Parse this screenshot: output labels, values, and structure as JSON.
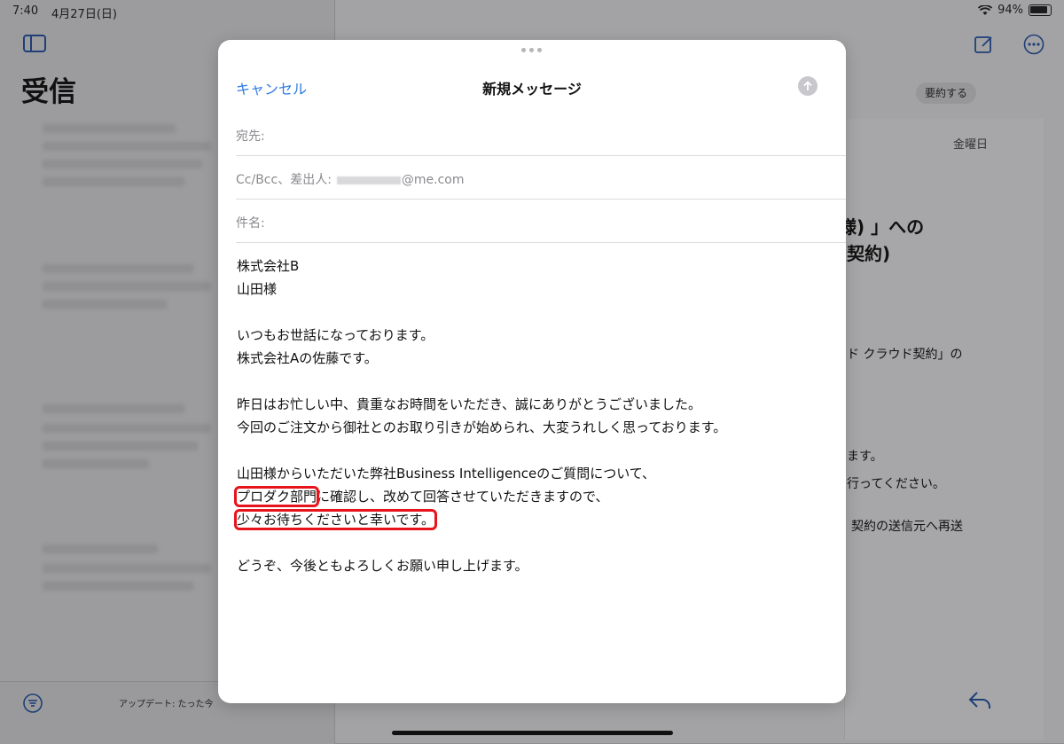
{
  "status_bar": {
    "time": "7:40",
    "date": "4月27日(日)",
    "battery": "94%"
  },
  "mailbox": {
    "title": "受信",
    "update_status": "アップデート: たった今"
  },
  "detail": {
    "summarize_label": "要約する",
    "date_label": "金曜日",
    "heading_line1": "様) 」への",
    "heading_line2": "契約)",
    "text1": "ド クラウド契約」の",
    "text2": "ます。",
    "text3": "行ってください。",
    "text4": "契約の送信元へ再送"
  },
  "compose": {
    "cancel_label": "キャンセル",
    "title": "新規メッセージ",
    "to_label": "宛先:",
    "cc_label": "Cc/Bcc、差出人:",
    "from_domain": "@me.com",
    "subject_label": "件名:",
    "body": {
      "l1": "株式会社B",
      "l2": "山田様",
      "l3": "いつもお世話になっております。",
      "l4": "株式会社Aの佐藤です。",
      "l5": "昨日はお忙しい中、貴重なお時間をいただき、誠にありがとうございました。",
      "l6": "今回のご注文から御社とのお取り引きが始められ、大変うれしく思っております。",
      "l7": "山田様からいただいた弊社Business Intelligenceのご質問について、",
      "l8_marked": "プロダク部門",
      "l8_rest": "に確認し、改めて回答させていただきますので、",
      "l9_marked": "少々お待ちくださいと幸いです。",
      "l10": "どうぞ、今後ともよろしくお願い申し上げます。"
    }
  }
}
